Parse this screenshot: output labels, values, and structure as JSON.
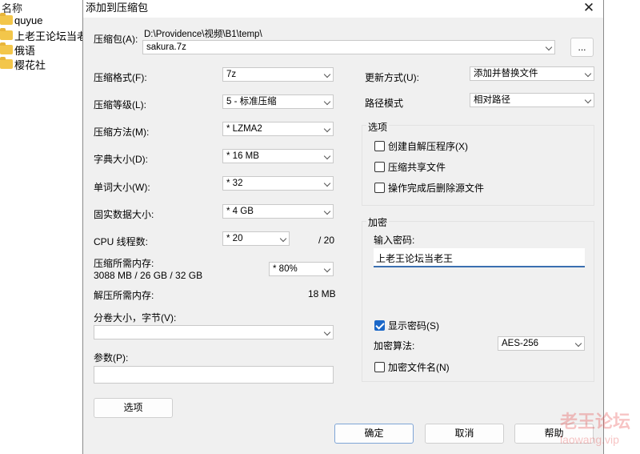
{
  "explorer": {
    "header": "名称",
    "items": [
      "quyue",
      "上老王论坛当老",
      "俄语",
      "樱花社"
    ]
  },
  "dialog": {
    "title": "添加到压缩包",
    "archive_label": "压缩包(A):",
    "archive_path": "D:\\Providence\\视频\\B1\\temp\\",
    "archive_name": "sakura.7z",
    "browse_label": "...",
    "format_label": "压缩格式(F):",
    "format_value": "7z",
    "level_label": "压缩等级(L):",
    "level_value": "5 - 标准压缩",
    "method_label": "压缩方法(M):",
    "method_value": "*  LZMA2",
    "dict_label": "字典大小(D):",
    "dict_value": "*  16 MB",
    "word_label": "单词大小(W):",
    "word_value": "*  32",
    "solid_label": "固实数据大小:",
    "solid_value": "*  4 GB",
    "threads_label": "CPU 线程数:",
    "threads_value": "*  20",
    "threads_total": "/ 20",
    "mem_comp_label": "压缩所需内存:",
    "mem_comp_value": "3088 MB / 26 GB / 32 GB",
    "mem_percent": "*  80%",
    "mem_decomp_label": "解压所需内存:",
    "mem_decomp_value": "18 MB",
    "volume_label": "分卷大小，字节(V):",
    "volume_value": "",
    "params_label": "参数(P):",
    "params_value": "",
    "options_button": "选项",
    "update_label": "更新方式(U):",
    "update_value": "添加并替换文件",
    "path_label": "路径模式",
    "path_value": "相对路径",
    "options_group": "选项",
    "opt_sfx": "创建自解压程序(X)",
    "opt_shared": "压缩共享文件",
    "opt_delete": "操作完成后删除源文件",
    "encrypt_group": "加密",
    "password_label": "输入密码:",
    "password_value": "上老王论坛当老王",
    "show_password": "显示密码(S)",
    "encrypt_method_label": "加密算法:",
    "encrypt_method_value": "AES-256",
    "encrypt_names": "加密文件名(N)",
    "ok": "确定",
    "cancel": "取消",
    "help": "帮助",
    "close": "✕"
  },
  "watermark": {
    "line1": "老王论坛",
    "line2": "laowang.vip"
  }
}
